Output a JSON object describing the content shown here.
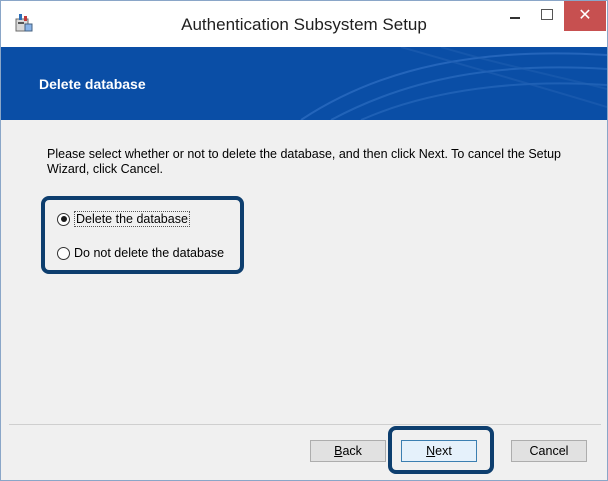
{
  "window": {
    "title": "Authentication Subsystem Setup",
    "icon": "installer-icon",
    "controls": {
      "minimize_icon": "minimize-icon",
      "maximize_icon": "maximize-icon",
      "close_label": "✕"
    }
  },
  "banner": {
    "title": "Delete database",
    "background": "#0a4ea6"
  },
  "instruction": "Please select whether or not to delete the database, and then click Next. To cancel the Setup Wizard, click Cancel.",
  "options": [
    {
      "label": "Delete the database",
      "checked": true
    },
    {
      "label": "Do not delete the database",
      "checked": false
    }
  ],
  "buttons": {
    "back": {
      "mnemonic": "B",
      "rest": "ack"
    },
    "next": {
      "mnemonic": "N",
      "rest": "ext"
    },
    "cancel": "Cancel"
  },
  "highlight_color": "#0d3e6e"
}
